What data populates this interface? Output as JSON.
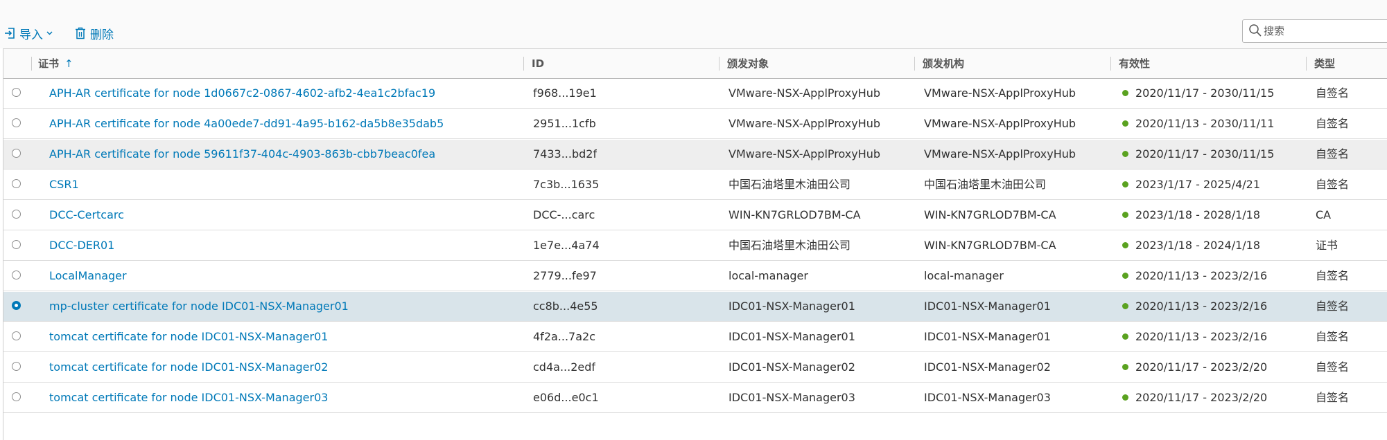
{
  "toolbar": {
    "import_label": "导入",
    "delete_label": "删除"
  },
  "search": {
    "placeholder": "搜索"
  },
  "columns": [
    {
      "label": "证书"
    },
    {
      "label": "ID"
    },
    {
      "label": "颁发对象"
    },
    {
      "label": "颁发机构"
    },
    {
      "label": "有效性"
    },
    {
      "label": "类型"
    }
  ],
  "sort": {
    "arrow": "↑"
  },
  "rows": [
    {
      "name": "APH-AR certificate for node 1d0667c2-0867-4602-afb2-4ea1c2bfac19",
      "id": "f968...19e1",
      "issued_to": "VMware-NSX-ApplProxyHub",
      "issued_by": "VMware-NSX-ApplProxyHub",
      "validity": "2020/11/17 - 2030/11/15",
      "type": "自签名",
      "selected": false
    },
    {
      "name": "APH-AR certificate for node 4a00ede7-dd91-4a95-b162-da5b8e35dab5",
      "id": "2951...1cfb",
      "issued_to": "VMware-NSX-ApplProxyHub",
      "issued_by": "VMware-NSX-ApplProxyHub",
      "validity": "2020/11/13 - 2030/11/11",
      "type": "自签名",
      "selected": false
    },
    {
      "name": "APH-AR certificate for node 59611f37-404c-4903-863b-cbb7beac0fea",
      "id": "7433...bd2f",
      "issued_to": "VMware-NSX-ApplProxyHub",
      "issued_by": "VMware-NSX-ApplProxyHub",
      "validity": "2020/11/17 - 2030/11/15",
      "type": "自签名",
      "selected": false
    },
    {
      "name": "CSR1",
      "id": "7c3b...1635",
      "issued_to": "中国石油塔里木油田公司",
      "issued_by": "中国石油塔里木油田公司",
      "validity": "2023/1/17 - 2025/4/21",
      "type": "自签名",
      "selected": false
    },
    {
      "name": "DCC-Certcarc",
      "id": "DCC-...carc",
      "issued_to": "WIN-KN7GRLOD7BM-CA",
      "issued_by": "WIN-KN7GRLOD7BM-CA",
      "validity": "2023/1/18 - 2028/1/18",
      "type": "CA",
      "selected": false
    },
    {
      "name": "DCC-DER01",
      "id": "1e7e...4a74",
      "issued_to": "中国石油塔里木油田公司",
      "issued_by": "WIN-KN7GRLOD7BM-CA",
      "validity": "2023/1/18 - 2024/1/18",
      "type": "证书",
      "selected": false
    },
    {
      "name": "LocalManager",
      "id": "2779...fe97",
      "issued_to": "local-manager",
      "issued_by": "local-manager",
      "validity": "2020/11/13 - 2023/2/16",
      "type": "自签名",
      "selected": false
    },
    {
      "name": "mp-cluster certificate for node IDC01-NSX-Manager01",
      "id": "cc8b...4e55",
      "issued_to": "IDC01-NSX-Manager01",
      "issued_by": "IDC01-NSX-Manager01",
      "validity": "2020/11/13 - 2023/2/16",
      "type": "自签名",
      "selected": true
    },
    {
      "name": "tomcat certificate for node IDC01-NSX-Manager01",
      "id": "4f2a...7a2c",
      "issued_to": "IDC01-NSX-Manager01",
      "issued_by": "IDC01-NSX-Manager01",
      "validity": "2020/11/13 - 2023/2/16",
      "type": "自签名",
      "selected": false
    },
    {
      "name": "tomcat certificate for node IDC01-NSX-Manager02",
      "id": "cd4a...2edf",
      "issued_to": "IDC01-NSX-Manager02",
      "issued_by": "IDC01-NSX-Manager02",
      "validity": "2020/11/17 - 2023/2/20",
      "type": "自签名",
      "selected": false
    },
    {
      "name": "tomcat certificate for node IDC01-NSX-Manager03",
      "id": "e06d...e0c1",
      "issued_to": "IDC01-NSX-Manager03",
      "issued_by": "IDC01-NSX-Manager03",
      "validity": "2020/11/17 - 2023/2/20",
      "type": "自签名",
      "selected": false
    }
  ],
  "colors": {
    "link": "#0079b8",
    "status_ok": "#5aa220",
    "selected_row": "#d9e4ea"
  },
  "icons": {
    "import": "import-icon",
    "delete": "trash-icon",
    "search": "search-icon",
    "sort": "sort-ascending-icon",
    "status": "status-ok-dot"
  }
}
